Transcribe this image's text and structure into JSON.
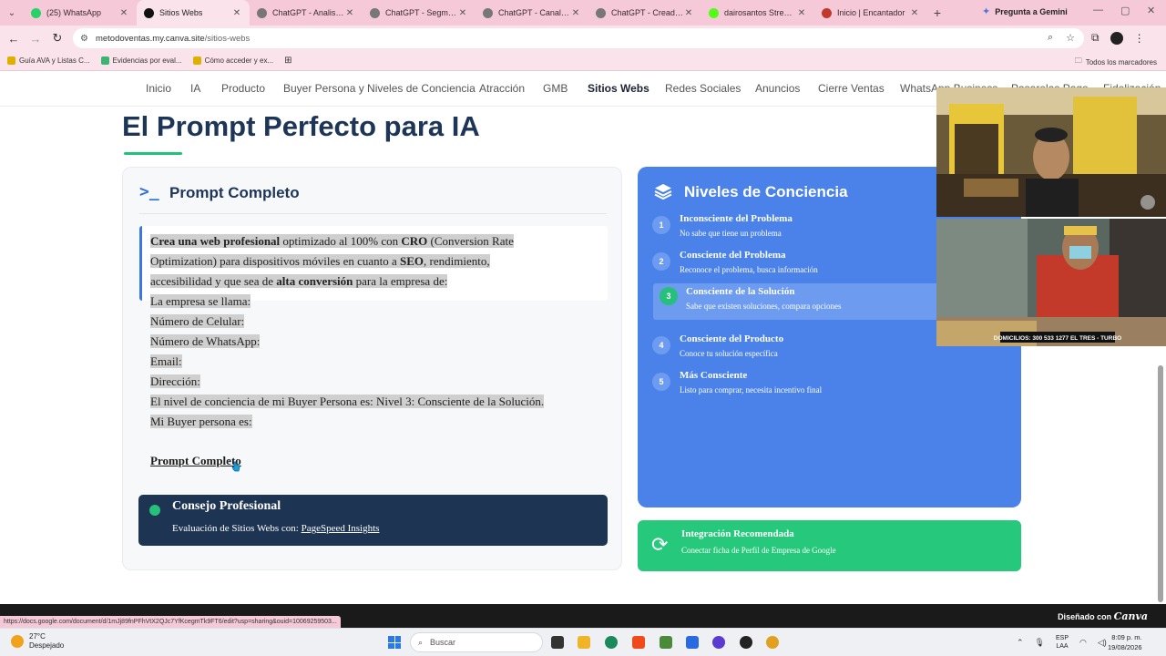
{
  "browser": {
    "tabs": [
      {
        "title": "(25) WhatsApp",
        "color": "#25d366",
        "active": false
      },
      {
        "title": "Sitios Webs",
        "color": "#111111",
        "active": true
      },
      {
        "title": "ChatGPT - Analista de",
        "color": "#777777",
        "active": false
      },
      {
        "title": "ChatGPT - Segmentac",
        "color": "#777777",
        "active": false
      },
      {
        "title": "ChatGPT - Canal Vent",
        "color": "#777777",
        "active": false
      },
      {
        "title": "ChatGPT - Creador de",
        "color": "#777777",
        "active": false
      },
      {
        "title": "dairosantos Stream -",
        "color": "#53fc18",
        "active": false
      },
      {
        "title": "Inicio | Encantador",
        "color": "#c0392b",
        "active": false
      }
    ],
    "gemini_label": "Pregunta a Gemini",
    "url_host": "metodoventas.my.canva.site",
    "url_path": "/sitios-webs",
    "bookmarks": [
      {
        "label": "Guía AVA y Listas C...",
        "color": "#e0b000"
      },
      {
        "label": "Evidencias por eval...",
        "color": "#3cb371"
      },
      {
        "label": "Cómo acceder y ex...",
        "color": "#e0b000"
      }
    ],
    "all_bookmarks": "Todos los marcadores"
  },
  "nav": {
    "items": [
      "Inicio",
      "IA",
      "Producto",
      "Buyer Persona y Niveles de Conciencia",
      "Atracción",
      "GMB",
      "Sitios Webs",
      "Redes Sociales",
      "Anuncios",
      "Cierre Ventas",
      "WhatsApp Business",
      "Pasarelas Pago",
      "Fidelización"
    ],
    "active": "Sitios Webs"
  },
  "page": {
    "title": "El Prompt Perfecto para IA"
  },
  "prompt_card": {
    "title": "Prompt Completo",
    "line1_b1": "Crea una web profesional",
    "line1_t1": " optimizado al 100% con ",
    "line1_b2": "CRO",
    "line1_t2": " (Conversion Rate",
    "line2_t1": "Optimization) para dispositivos móviles en cuanto a ",
    "line2_b1": "SEO",
    "line2_t2": ", rendimiento,",
    "line3_t1": "accesibilidad y que sea de ",
    "line3_b1": "alta conversión",
    "line3_t2": " para la empresa de:",
    "fields": [
      "La empresa se llama:",
      "Número de Celular:",
      "Número de WhatsApp:",
      "Email:",
      "Dirección:",
      "El nivel de conciencia de mi Buyer Persona es: Nivel 3: Consciente de la Solución.",
      "Mi Buyer persona es:"
    ],
    "link_label": "Prompt Completo",
    "tip_title": "Consejo Profesional",
    "tip_text": "Evaluación de Sitios Webs con: ",
    "tip_link": "PageSpeed Insights"
  },
  "levels_card": {
    "title": "Niveles de Conciencia",
    "levels": [
      {
        "num": "1",
        "title": "Inconsciente del Problema",
        "desc": "No sabe que tiene un problema"
      },
      {
        "num": "2",
        "title": "Consciente del Problema",
        "desc": "Reconoce el problema, busca información"
      },
      {
        "num": "3",
        "title": "Consciente de la Solución",
        "desc": "Sabe que existen soluciones, compara opciones"
      },
      {
        "num": "4",
        "title": "Consciente del Producto",
        "desc": "Conoce tu solución específica"
      },
      {
        "num": "5",
        "title": "Más Consciente",
        "desc": "Listo para comprar, necesita incentivo final"
      }
    ],
    "highlighted": "3"
  },
  "integration_card": {
    "title": "Integración Recomendada",
    "text": "Conectar ficha de Perfil de Empresa de Google"
  },
  "webcam": {
    "overlay_text": "DOMICILIOS: 300 533 1277 EL TRES - TURBO"
  },
  "footer": {
    "status_url": "https://docs.google.com/document/d/1mJj89fnPFhVtX2QJc7YfKcegmTk9FT6/edit?usp=sharing&ouid=10069259503...",
    "canva_prefix": "Diseñado con",
    "canva_brand": "Canva"
  },
  "taskbar": {
    "temp": "27°C",
    "weather": "Despejado",
    "search_placeholder": "Buscar",
    "lang1": "ESP",
    "lang2": "LAA",
    "time": "8:09 p. m.",
    "date": "19/08/2026"
  }
}
